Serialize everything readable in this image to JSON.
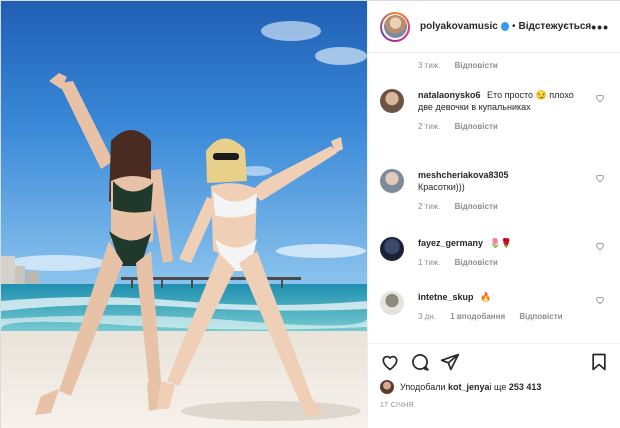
{
  "header": {
    "username": "polyakovamusic",
    "separator": "•",
    "follow_status": "Відстежується",
    "more": "•••"
  },
  "top_meta": {
    "time": "3 тиж.",
    "reply": "Відповісти"
  },
  "comments": [
    {
      "user": "natalaonysko6",
      "text": "Ето просто 😏 плохо две девочки в купальниках",
      "time": "2 тиж.",
      "likes": "",
      "reply": "Відповісти"
    },
    {
      "user": "meshcheriakova8305",
      "text": "Красотки)))",
      "time": "2 тиж.",
      "likes": "",
      "reply": "Відповісти"
    },
    {
      "user": "fayez_germany",
      "text": "🌷🌹",
      "time": "1 тиж.",
      "likes": "",
      "reply": "Відповісти"
    },
    {
      "user": "intetne_skup",
      "text": "🔥",
      "time": "3 дн.",
      "likes": "1 вподобання",
      "reply": "Відповісти"
    }
  ],
  "likes": {
    "prefix": "Уподобали ",
    "user": "kot_jenya",
    "middle": " і ще ",
    "count": "253 413"
  },
  "date": "17 СІЧНЯ",
  "colors": {
    "link_blue": "#3897f0",
    "muted": "#8e8e8e",
    "text": "#262626"
  }
}
